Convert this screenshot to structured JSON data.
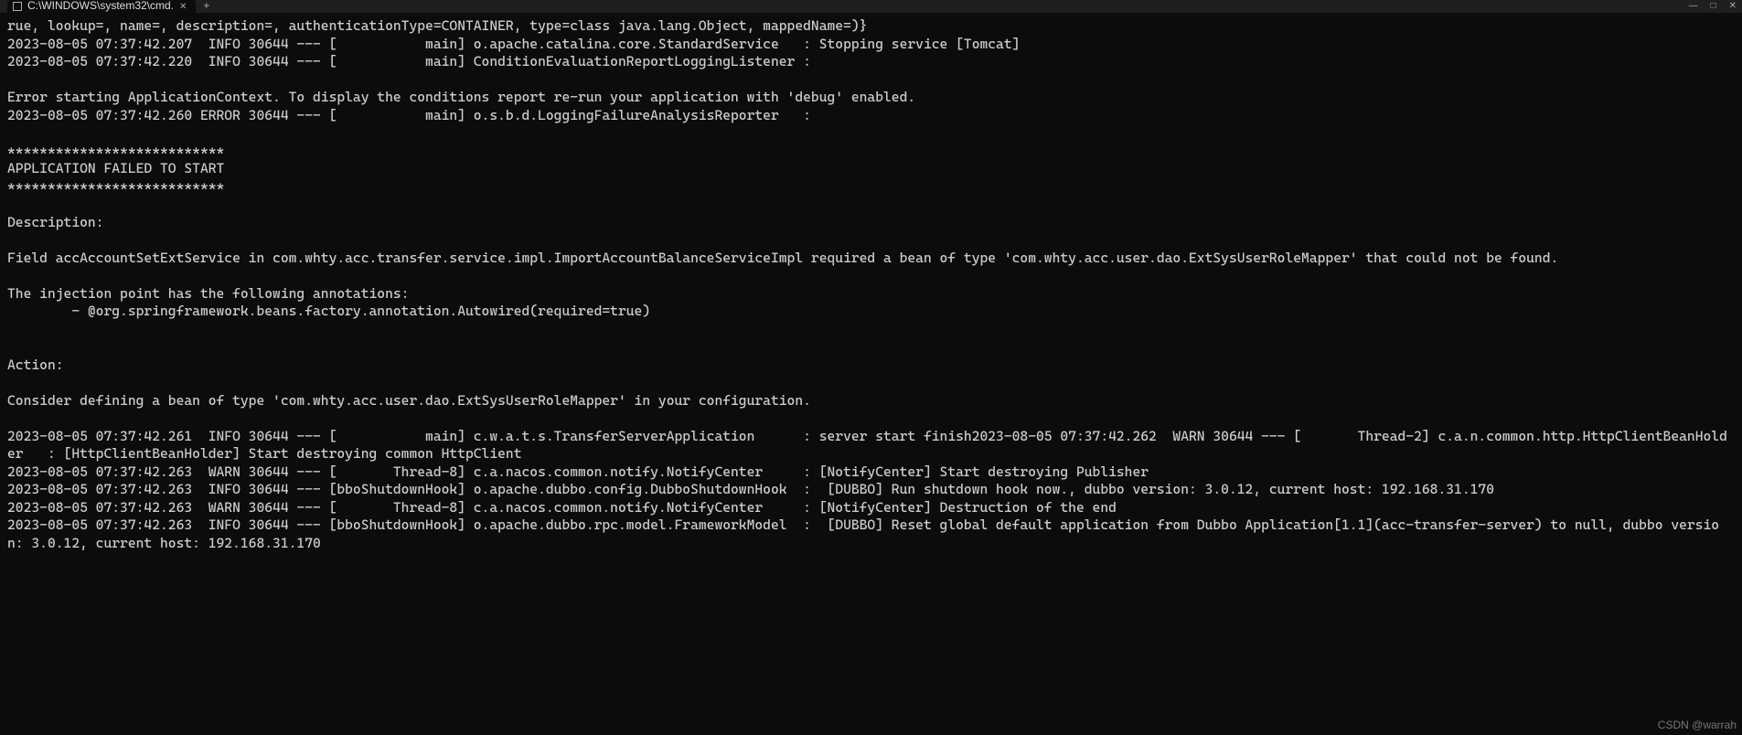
{
  "titlebar": {
    "tab_label": "C:\\WINDOWS\\system32\\cmd.",
    "close_glyph": "✕",
    "newtab_glyph": "+",
    "min_glyph": "—",
    "max_glyph": "□",
    "winclose_glyph": "✕"
  },
  "log": {
    "line01": "rue, lookup=, name=, description=, authenticationType=CONTAINER, type=class java.lang.Object, mappedName=)}",
    "line02": "2023-08-05 07:37:42.207  INFO 30644 --- [           main] o.apache.catalina.core.StandardService   : Stopping service [Tomcat]",
    "line03": "2023-08-05 07:37:42.220  INFO 30644 --- [           main] ConditionEvaluationReportLoggingListener :",
    "line04": "",
    "line05": "Error starting ApplicationContext. To display the conditions report re-run your application with 'debug' enabled.",
    "line06": "2023-08-05 07:37:42.260 ERROR 30644 --- [           main] o.s.b.d.LoggingFailureAnalysisReporter   :",
    "line07": "",
    "line08": "***************************",
    "line09": "APPLICATION FAILED TO START",
    "line10": "***************************",
    "line11": "",
    "line12": "Description:",
    "line13": "",
    "line14": "Field accAccountSetExtService in com.whty.acc.transfer.service.impl.ImportAccountBalanceServiceImpl required a bean of type 'com.whty.acc.user.dao.ExtSysUserRoleMapper' that could not be found.",
    "line15": "",
    "line16": "The injection point has the following annotations:",
    "line17": "        - @org.springframework.beans.factory.annotation.Autowired(required=true)",
    "line18": "",
    "line19": "",
    "line20": "Action:",
    "line21": "",
    "line22": "Consider defining a bean of type 'com.whty.acc.user.dao.ExtSysUserRoleMapper' in your configuration.",
    "line23": "",
    "line24": "2023-08-05 07:37:42.261  INFO 30644 --- [           main] c.w.a.t.s.TransferServerApplication      : server start finish2023-08-05 07:37:42.262  WARN 30644 --- [       Thread-2] c.a.n.common.http.HttpClientBeanHolder   : [HttpClientBeanHolder] Start destroying common HttpClient",
    "line25": "2023-08-05 07:37:42.263  WARN 30644 --- [       Thread-8] c.a.nacos.common.notify.NotifyCenter     : [NotifyCenter] Start destroying Publisher",
    "line26": "2023-08-05 07:37:42.263  INFO 30644 --- [bboShutdownHook] o.apache.dubbo.config.DubboShutdownHook  :  [DUBBO] Run shutdown hook now., dubbo version: 3.0.12, current host: 192.168.31.170",
    "line27": "2023-08-05 07:37:42.263  WARN 30644 --- [       Thread-8] c.a.nacos.common.notify.NotifyCenter     : [NotifyCenter] Destruction of the end",
    "line28": "2023-08-05 07:37:42.263  INFO 30644 --- [bboShutdownHook] o.apache.dubbo.rpc.model.FrameworkModel  :  [DUBBO] Reset global default application from Dubbo Application[1.1](acc-transfer-server) to null, dubbo version: 3.0.12, current host: 192.168.31.170"
  },
  "watermark": "CSDN @warrah"
}
